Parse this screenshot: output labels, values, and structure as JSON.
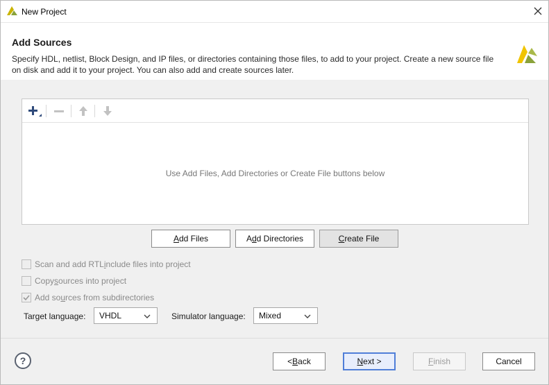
{
  "window": {
    "title": "New Project",
    "close_icon": "close-icon",
    "app_icon": "vivado-logo-icon"
  },
  "header": {
    "title": "Add Sources",
    "description_line1": "Specify HDL, netlist, Block Design, and IP files, or directories containing those files, to add to your project. Create a new source file",
    "description_line2": "on disk and add it to your project. You can also add and create sources later.",
    "logo_icon": "xilinx-logo-icon"
  },
  "toolbar": {
    "add_icon": "plus-icon",
    "remove_icon": "minus-icon",
    "move_up_icon": "arrow-up-icon",
    "move_down_icon": "arrow-down-icon"
  },
  "file_list": {
    "empty_message": "Use Add Files, Add Directories or Create File buttons below"
  },
  "buttons": {
    "add_files": {
      "pre": "",
      "u": "A",
      "post": "dd Files"
    },
    "add_directories": {
      "pre": "A",
      "u": "d",
      "post": "d Directories"
    },
    "create_file": {
      "pre": "",
      "u": "C",
      "post": "reate File"
    }
  },
  "options": {
    "scan_rtl": {
      "pre": "Scan and add RTL ",
      "u": "i",
      "post": "nclude files into project",
      "checked": false
    },
    "copy_sources": {
      "pre": "Copy ",
      "u": "s",
      "post": "ources into project",
      "checked": false
    },
    "add_subdirs": {
      "pre": "Add so",
      "u": "u",
      "post": "rces from subdirectories",
      "checked": true
    }
  },
  "languages": {
    "target_label": "Target language:",
    "target_value": "VHDL",
    "simulator_label": "Simulator language:",
    "simulator_value": "Mixed"
  },
  "footer": {
    "help_label": "?",
    "back": {
      "pre": "< ",
      "u": "B",
      "post": "ack"
    },
    "next": {
      "pre": "",
      "u": "N",
      "post": "ext >"
    },
    "finish": {
      "pre": "",
      "u": "F",
      "post": "inish"
    },
    "cancel_label": "Cancel"
  },
  "colors": {
    "accent": "#4f7ed8",
    "logo_yellow": "#f5c400",
    "logo_green": "#8aa23a"
  }
}
